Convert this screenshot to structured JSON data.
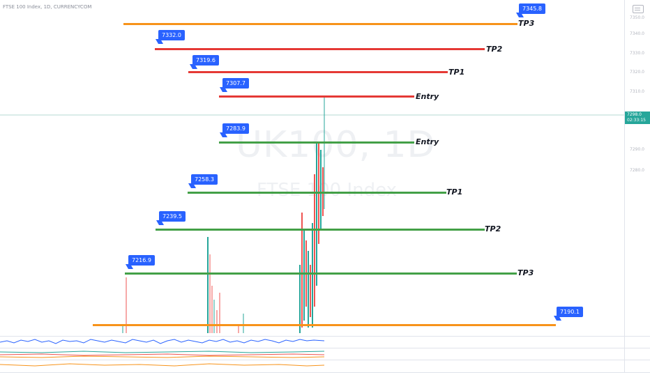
{
  "symbol": {
    "title": "FTSE 100 Index, 1D, CURRENCYCOM",
    "watermark_symbol": "UK100, 1D",
    "watermark_desc": "FTSE 100 Index"
  },
  "colors": {
    "tp3_orange": "#f7931a",
    "red": "#e53935",
    "green": "#43a047",
    "tag_blue": "#2962ff",
    "up_candle": "#26a69a",
    "down_candle": "#ef5350"
  },
  "levels": [
    {
      "id": "sell-tp3",
      "price": "7345.8",
      "label": "TP3",
      "color": "#f7931a"
    },
    {
      "id": "sell-tp2",
      "price": "7332.0",
      "label": "TP2",
      "color": "#e53935"
    },
    {
      "id": "sell-tp1",
      "price": "7319.6",
      "label": "TP1",
      "color": "#e53935"
    },
    {
      "id": "sell-entry",
      "price": "7307.7",
      "label": "Entry",
      "color": "#e53935"
    },
    {
      "id": "buy-entry",
      "price": "7283.9",
      "label": "Entry",
      "color": "#43a047"
    },
    {
      "id": "buy-tp1",
      "price": "7258.3",
      "label": "TP1",
      "color": "#43a047"
    },
    {
      "id": "buy-tp2",
      "price": "7239.5",
      "label": "TP2",
      "color": "#43a047"
    },
    {
      "id": "buy-tp3",
      "price": "7216.9",
      "label": "TP3",
      "color": "#43a047"
    },
    {
      "id": "bottom-level",
      "price": "7190.1",
      "label": "",
      "color": "#f7931a"
    }
  ],
  "price_axis": {
    "labels": [
      "7350.0",
      "7340.0",
      "7330.0",
      "7320.0",
      "7310.0",
      "7300.0",
      "7290.0",
      "7280.0",
      "7270.0"
    ],
    "current_price": "7298.0",
    "countdown": "02:33:15"
  }
}
